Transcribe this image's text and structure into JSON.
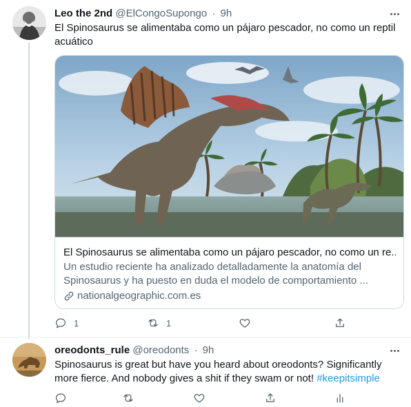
{
  "tweets": [
    {
      "display_name": "Leo the 2nd",
      "handle": "@ElCongoSupongo",
      "separator": "·",
      "time": "9h",
      "text": "El Spinosaurus se alimentaba como un pájaro pescador, no como un reptil acuático",
      "card": {
        "title": "El Spinosaurus se alimentaba como un pájaro pescador, no como un re...",
        "description": "Un estudio reciente ha analizado detalladamente la anatomía del Spinosaurus y ha puesto en duda el modelo de comportamiento ...",
        "domain": "nationalgeographic.com.es"
      },
      "actions": {
        "reply_count": "1",
        "retweet_count": "1",
        "like_count": "",
        "share": ""
      }
    },
    {
      "display_name": "oreodonts_rule",
      "handle": "@oreodonts",
      "separator": "·",
      "time": "9h",
      "text_plain": "Spinosaurus is great but have you heard about oreodonts? Significantly more fierce. And nobody gives a shit if they swam or not! ",
      "hashtag": "#keepitsimple",
      "actions": {
        "reply_count": "",
        "retweet_count": "",
        "like_count": ""
      }
    }
  ],
  "icons": {
    "more": "more-horizontal-icon",
    "reply": "reply-icon",
    "retweet": "retweet-icon",
    "like": "heart-icon",
    "share": "share-icon",
    "analytics": "analytics-icon",
    "link": "link-icon"
  },
  "colors": {
    "hashtag": "#1d9bf0",
    "secondary_text": "#536471",
    "border": "#cfd9de"
  }
}
